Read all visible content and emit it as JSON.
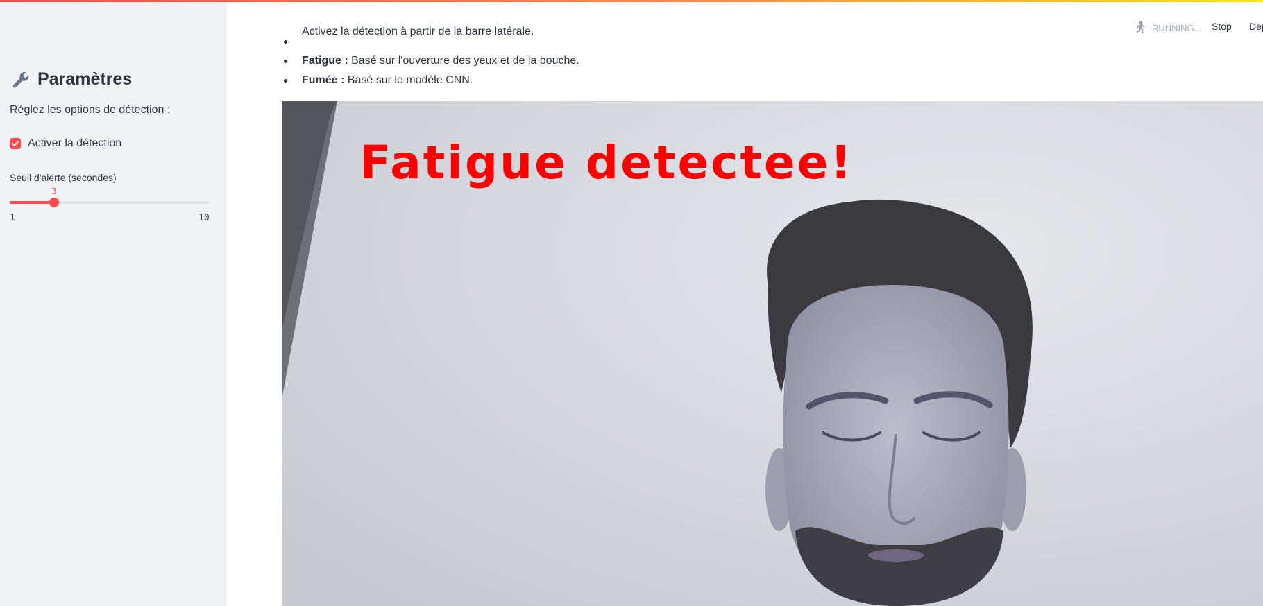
{
  "sidebar": {
    "title": "Paramètres",
    "title_icon": "wrench-icon",
    "subtitle": "Réglez les options de détection :",
    "checkbox": {
      "label": "Activer la détection",
      "checked": true
    },
    "slider": {
      "label": "Seuil d'alerte (secondes)",
      "value": 3,
      "min": 1,
      "max": 10,
      "value_text": "3",
      "min_text": "1",
      "max_text": "10"
    }
  },
  "header": {
    "status_icon": "running-person-icon",
    "status": "RUNNING...",
    "stop_label": "Stop",
    "deploy_label": "Deploy"
  },
  "main": {
    "intro_items": [
      {
        "bold": "",
        "text": "Activez la détection à partir de la barre latérale."
      },
      {
        "bold": "Fatigue :",
        "text": " Basé sur l'ouverture des yeux et de la bouche."
      },
      {
        "bold": "Fumée :",
        "text": " Basé sur le modèle CNN."
      }
    ],
    "video_overlay_text": "Fatigue detectee!"
  },
  "colors": {
    "accent": "#ff4b4b",
    "sidebar_bg": "#f0f2f6",
    "overlay_text": "#ff0000"
  }
}
